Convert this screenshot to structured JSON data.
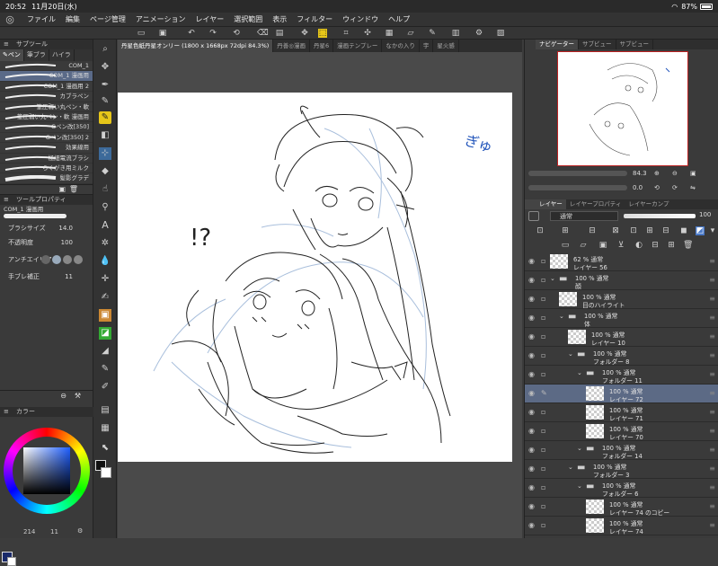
{
  "status": {
    "time": "20:52",
    "date": "11月20日(水)",
    "battery": "87%"
  },
  "menu": [
    "ファイル",
    "編集",
    "ページ管理",
    "アニメーション",
    "レイヤー",
    "選択範囲",
    "表示",
    "フィルター",
    "ウィンドウ",
    "ヘルプ"
  ],
  "subtool": {
    "panel_title": "サブツール",
    "tabs": [
      "ペン",
      "筆ブラ",
      "ハイラ"
    ],
    "brushes": [
      "COM_1",
      "COM_1 漫画用",
      "COM_1 漫画用 2",
      "カブラペン",
      "筆圧弱い丸ペン・軟",
      "筆圧弱い丸ペン・軟 漫画用",
      "Gペン改[350]",
      "Gペン改[350] 2",
      "効果線用",
      "極細電流ブラシ",
      "らくがき用ミルク",
      "髪影グラデ"
    ]
  },
  "toolprops": {
    "panel_title": "ツールプロパティ",
    "current": "COM_1 漫画用",
    "brush_size_label": "ブラシサイズ",
    "brush_size": "14.0",
    "opacity_label": "不透明度",
    "opacity": "100",
    "antialias_label": "アンチエイリア",
    "stabilization_label": "手ブレ補正",
    "stabilization": "11"
  },
  "colorpanel": {
    "title": "カラー",
    "footer": "214",
    "footer2": "11"
  },
  "documents": [
    "丹星色紙丹星オンリー (1800 x 1668px 72dpi 84.3%)",
    "丹善◎漫画",
    "丹星6",
    "漫画テンプレー",
    "なかの入り",
    "宇",
    "星火感"
  ],
  "canvas": {
    "onomatopoeia": "ぎゅ",
    "exclaim": "!?"
  },
  "navigator": {
    "tabs": [
      "ナビゲーター",
      "サブビュー",
      "サブビュー"
    ],
    "zoom": "84.3",
    "angle": "0.0"
  },
  "layers": {
    "tabs": [
      "レイヤー",
      "レイヤープロパティ",
      "レイヤーカンプ"
    ],
    "blend": "通常",
    "opacity": "100",
    "rows": [
      {
        "pct": "62 %",
        "mode": "通常",
        "name": "レイヤー 56",
        "indent": 0,
        "type": "layer"
      },
      {
        "pct": "100 %",
        "mode": "通常",
        "name": "顔",
        "indent": 0,
        "type": "folder"
      },
      {
        "pct": "100 %",
        "mode": "通常",
        "name": "目のハイライト",
        "indent": 1,
        "type": "layer"
      },
      {
        "pct": "100 %",
        "mode": "通常",
        "name": "体",
        "indent": 1,
        "type": "folder"
      },
      {
        "pct": "100 %",
        "mode": "通常",
        "name": "レイヤー 10",
        "indent": 2,
        "type": "layer"
      },
      {
        "pct": "100 %",
        "mode": "通常",
        "name": "フォルダー 8",
        "indent": 2,
        "type": "folder"
      },
      {
        "pct": "100 %",
        "mode": "通常",
        "name": "フォルダー 11",
        "indent": 3,
        "type": "folder"
      },
      {
        "pct": "100 %",
        "mode": "通常",
        "name": "レイヤー 72",
        "indent": 4,
        "type": "layer",
        "selected": true
      },
      {
        "pct": "100 %",
        "mode": "通常",
        "name": "レイヤー 71",
        "indent": 4,
        "type": "layer"
      },
      {
        "pct": "100 %",
        "mode": "通常",
        "name": "レイヤー 70",
        "indent": 4,
        "type": "layer"
      },
      {
        "pct": "100 %",
        "mode": "通常",
        "name": "フォルダー 14",
        "indent": 3,
        "type": "folder"
      },
      {
        "pct": "100 %",
        "mode": "通常",
        "name": "フォルダー 3",
        "indent": 2,
        "type": "folder"
      },
      {
        "pct": "100 %",
        "mode": "通常",
        "name": "フォルダー 6",
        "indent": 3,
        "type": "folder"
      },
      {
        "pct": "100 %",
        "mode": "通常",
        "name": "レイヤー 74 のコピー",
        "indent": 4,
        "type": "layer"
      },
      {
        "pct": "100 %",
        "mode": "通常",
        "name": "レイヤー 74",
        "indent": 4,
        "type": "layer"
      }
    ]
  }
}
